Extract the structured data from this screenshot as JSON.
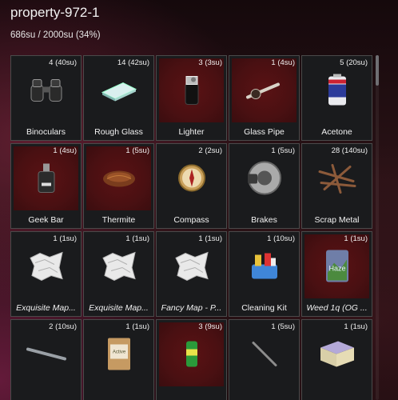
{
  "inventory": {
    "title": "property-972-1",
    "weight": "686su / 2000su (34%)"
  },
  "items": [
    {
      "qty": "4 (40su)",
      "label": "Binoculars",
      "icon": "binoculars-icon",
      "red": false,
      "italic": false
    },
    {
      "qty": "14 (42su)",
      "label": "Rough Glass",
      "icon": "glass-sheet-icon",
      "red": false,
      "italic": false
    },
    {
      "qty": "3 (3su)",
      "label": "Lighter",
      "icon": "lighter-icon",
      "red": true,
      "italic": false
    },
    {
      "qty": "1 (4su)",
      "label": "Glass Pipe",
      "icon": "glass-pipe-icon",
      "red": true,
      "italic": false
    },
    {
      "qty": "5 (20su)",
      "label": "Acetone",
      "icon": "acetone-can-icon",
      "red": false,
      "italic": false
    },
    {
      "qty": "1 (4su)",
      "label": "Geek Bar",
      "icon": "vape-icon",
      "red": true,
      "italic": false
    },
    {
      "qty": "1 (5su)",
      "label": "Thermite",
      "icon": "thermite-icon",
      "red": true,
      "italic": false
    },
    {
      "qty": "2 (2su)",
      "label": "Compass",
      "icon": "compass-icon",
      "red": false,
      "italic": false
    },
    {
      "qty": "1 (5su)",
      "label": "Brakes",
      "icon": "brake-disc-icon",
      "red": false,
      "italic": false
    },
    {
      "qty": "28 (140su)",
      "label": "Scrap Metal",
      "icon": "scrap-metal-icon",
      "red": false,
      "italic": false
    },
    {
      "qty": "1 (1su)",
      "label": "Exquisite Map...",
      "icon": "map-icon",
      "red": false,
      "italic": true
    },
    {
      "qty": "1 (1su)",
      "label": "Exquisite Map...",
      "icon": "map-icon",
      "red": false,
      "italic": true
    },
    {
      "qty": "1 (1su)",
      "label": "Fancy Map - P...",
      "icon": "map-icon",
      "red": false,
      "italic": true
    },
    {
      "qty": "1 (10su)",
      "label": "Cleaning Kit",
      "icon": "cleaning-kit-icon",
      "red": false,
      "italic": false
    },
    {
      "qty": "1 (1su)",
      "label": "Weed 1q (OG ...",
      "icon": "weed-bag-icon",
      "red": true,
      "italic": true
    },
    {
      "qty": "2 (10su)",
      "label": "",
      "icon": "rod-icon",
      "red": false,
      "italic": false
    },
    {
      "qty": "1 (1su)",
      "label": "",
      "icon": "yeast-bag-icon",
      "red": false,
      "italic": false
    },
    {
      "qty": "3 (9su)",
      "label": "",
      "icon": "energy-can-icon",
      "red": true,
      "italic": false
    },
    {
      "qty": "1 (5su)",
      "label": "",
      "icon": "stick-icon",
      "red": false,
      "italic": false
    },
    {
      "qty": "1 (1su)",
      "label": "",
      "icon": "box-icon",
      "red": false,
      "italic": false
    }
  ]
}
